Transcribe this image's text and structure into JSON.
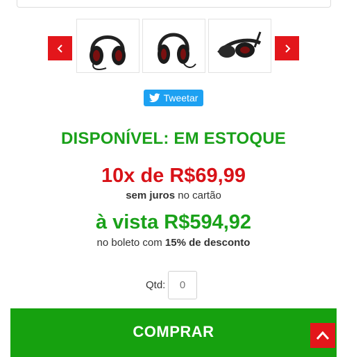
{
  "gallery": {
    "prev_icon": "chevron-left-icon",
    "next_icon": "chevron-right-icon",
    "accent_color": "#e3161b",
    "thumbnails": [
      {
        "icon": "headset-front-icon"
      },
      {
        "icon": "headset-front-icon"
      },
      {
        "icon": "headset-side-icon"
      }
    ]
  },
  "social": {
    "tweet_label": "Tweetar",
    "tweet_color": "#1da1f2",
    "icon": "twitter-bird-icon"
  },
  "product": {
    "availability": "DISPONÍVEL: EM ESTOQUE",
    "installments_price": "10x de R$69,99",
    "installments_bold": "sem juros",
    "installments_rest": " no cartão",
    "cash_price": "à vista R$594,92",
    "cash_note_prefix": "no boleto com ",
    "cash_note_bold": "15% de desconto",
    "price_color": "#d81218",
    "success_color": "#1aa11a"
  },
  "quantity": {
    "label": "Qtd:",
    "placeholder": "0"
  },
  "actions": {
    "buy_label": "COMPRAR",
    "buy_color": "#16a10f",
    "scroll_top_icon": "chevron-up-icon"
  }
}
